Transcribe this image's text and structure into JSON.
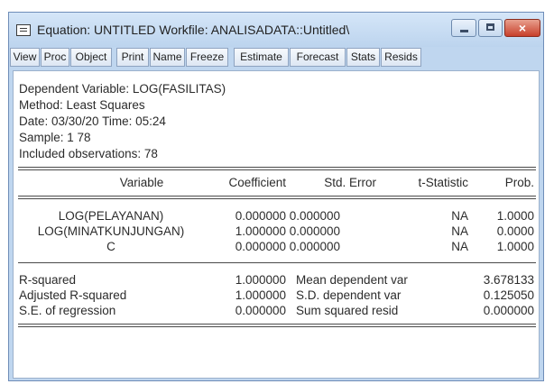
{
  "window": {
    "title": "Equation: UNTITLED   Workfile: ANALISADATA::Untitled\\",
    "icons": {
      "title": "equation-window-icon",
      "minimize": "minimize-icon",
      "maximize": "maximize-icon",
      "close": "close-icon"
    },
    "close_glyph": "×",
    "colors": {
      "frame": "#bfd6ef",
      "close_button": "#c8402b"
    }
  },
  "toolbar": {
    "view": "View",
    "proc": "Proc",
    "object": "Object",
    "print": "Print",
    "name": "Name",
    "freeze": "Freeze",
    "estimate": "Estimate",
    "forecast": "Forecast",
    "stats": "Stats",
    "resids": "Resids"
  },
  "output": {
    "header": {
      "dependent": "Dependent Variable: LOG(FASILITAS)",
      "method": "Method: Least Squares",
      "datetime": "Date: 03/30/20   Time: 05:24",
      "sample": "Sample: 1 78",
      "observations": "Included observations: 78"
    },
    "columns": {
      "variable": "Variable",
      "coefficient": "Coefficient",
      "std_error": "Std. Error",
      "t_stat": "t-Statistic",
      "prob": "Prob."
    },
    "rows": [
      {
        "variable": "LOG(PELAYANAN)",
        "coefficient": "0.000000",
        "std_error": "0.000000",
        "t_stat": "NA",
        "prob": "1.0000"
      },
      {
        "variable": "LOG(MINATKUNJUNGAN)",
        "coefficient": "1.000000",
        "std_error": "0.000000",
        "t_stat": "NA",
        "prob": "0.0000"
      },
      {
        "variable": "C",
        "coefficient": "0.000000",
        "std_error": "0.000000",
        "t_stat": "NA",
        "prob": "1.0000"
      }
    ],
    "stats": [
      {
        "label": "R-squared",
        "value": "1.000000",
        "label2": "Mean dependent var",
        "value2": "3.678133"
      },
      {
        "label": "Adjusted R-squared",
        "value": "1.000000",
        "label2": "S.D. dependent var",
        "value2": "0.125050"
      },
      {
        "label": "S.E. of regression",
        "value": "0.000000",
        "label2": "Sum squared resid",
        "value2": "0.000000"
      }
    ]
  }
}
